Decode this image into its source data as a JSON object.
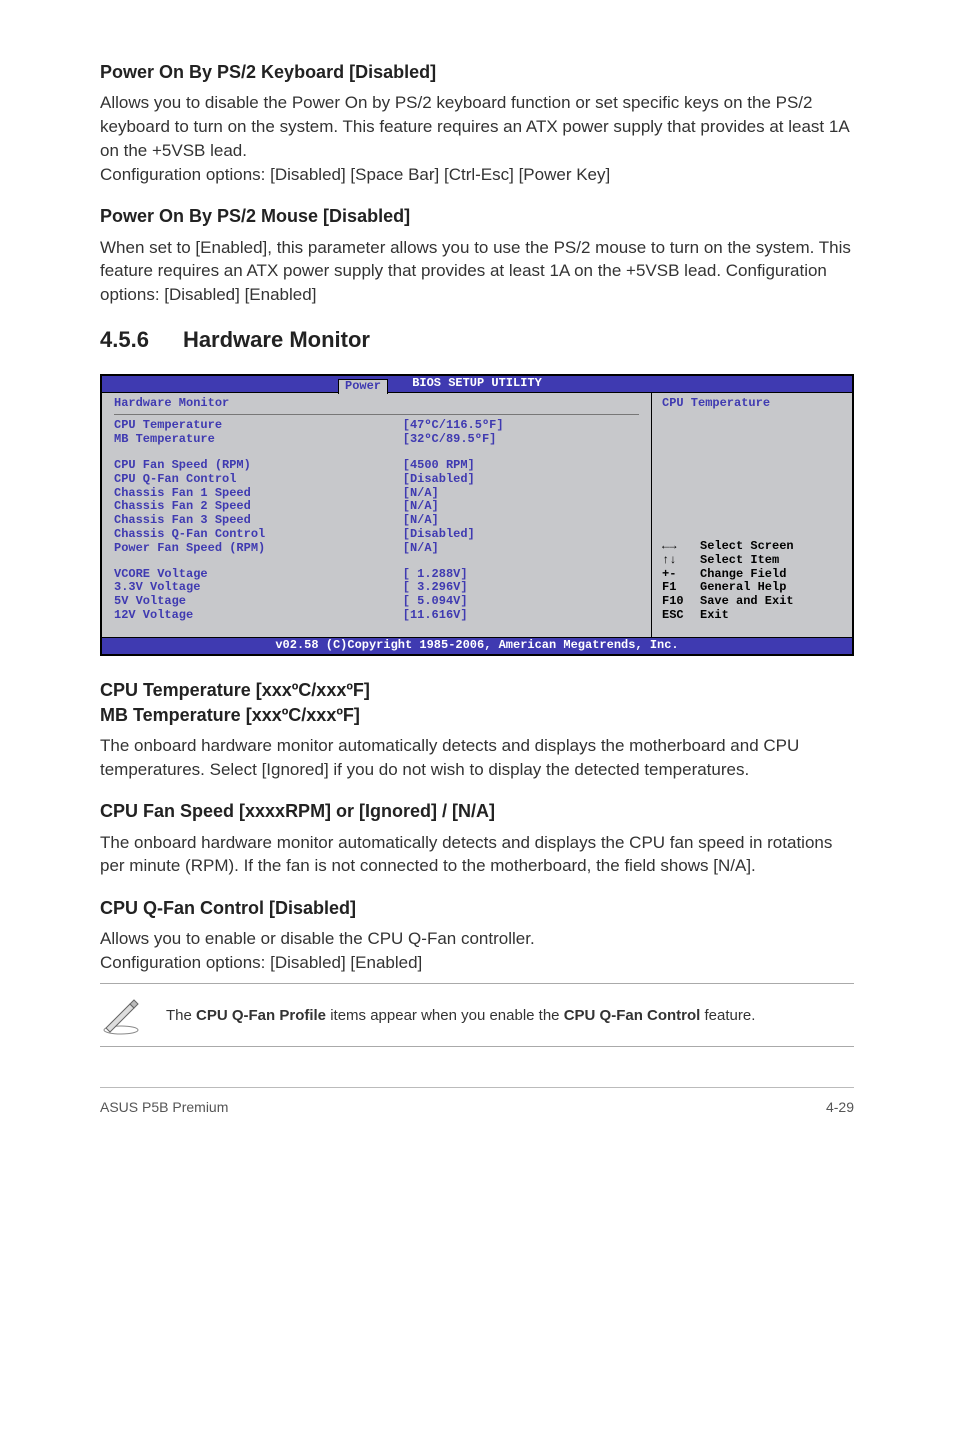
{
  "sections": {
    "block1": {
      "title": "Power On By PS/2 Keyboard [Disabled]",
      "body": "Allows you to disable the Power On by PS/2 keyboard function or set specific keys on the PS/2 keyboard to turn on the system. This feature requires an ATX power supply that provides at least 1A on the +5VSB lead.\nConfiguration options: [Disabled] [Space Bar] [Ctrl-Esc] [Power Key]"
    },
    "block2": {
      "title": "Power On By PS/2 Mouse [Disabled]",
      "body": "When set to [Enabled], this parameter allows you to use the PS/2 mouse to turn on the system. This feature requires an ATX power supply that provides at least 1A on the +5VSB lead. Configuration options: [Disabled] [Enabled]"
    },
    "section456": {
      "num": "4.5.6",
      "heading": "Hardware Monitor"
    },
    "temp": {
      "title_line1": "CPU Temperature [xxxºC/xxxºF]",
      "title_line2": "MB Temperature [xxxºC/xxxºF]",
      "body": "The onboard hardware monitor automatically detects and displays the motherboard and CPU temperatures. Select [Ignored] if you do not wish to display the detected temperatures."
    },
    "fanspeed": {
      "title": "CPU Fan Speed [xxxxRPM] or [Ignored] / [N/A]",
      "body": "The onboard hardware monitor automatically detects and displays the CPU fan speed in rotations per minute (RPM). If the fan is not connected to the motherboard, the field shows [N/A]."
    },
    "qfan": {
      "title": "CPU Q-Fan Control [Disabled]",
      "body": "Allows you to enable or disable the CPU Q-Fan controller.\nConfiguration options: [Disabled] [Enabled]"
    },
    "note": {
      "prefix": "The ",
      "bold1": "CPU Q-Fan Profile",
      "mid": " items appear when you enable the ",
      "bold2": "CPU Q-Fan Control",
      "suffix": " feature."
    }
  },
  "bios": {
    "header": "BIOS SETUP UTILITY",
    "tab": "Power",
    "panel_title": "Hardware Monitor",
    "rows_a": [
      {
        "label": "CPU Temperature",
        "val": "[47ºC/116.5ºF]"
      },
      {
        "label": "MB Temperature",
        "val": "[32ºC/89.5ºF]"
      }
    ],
    "rows_b": [
      {
        "label": "CPU Fan Speed (RPM)",
        "val": "[4500 RPM]"
      },
      {
        "label": "CPU Q-Fan Control",
        "val": "[Disabled]"
      },
      {
        "label": "Chassis Fan 1 Speed",
        "val": "[N/A]"
      },
      {
        "label": "Chassis Fan 2 Speed",
        "val": "[N/A]"
      },
      {
        "label": "Chassis Fan 3 Speed",
        "val": "[N/A]"
      },
      {
        "label": "Chassis Q-Fan Control",
        "val": "[Disabled]"
      },
      {
        "label": "Power Fan Speed (RPM)",
        "val": "[N/A]"
      }
    ],
    "rows_c": [
      {
        "label": "VCORE Voltage",
        "val": "[ 1.288V]"
      },
      {
        "label": "3.3V Voltage",
        "val": "[ 3.296V]"
      },
      {
        "label": "5V Voltage",
        "val": "[ 5.094V]"
      },
      {
        "label": "12V Voltage",
        "val": "[11.616V]"
      }
    ],
    "right_title": "CPU Temperature",
    "help": [
      {
        "k": "←→",
        "t": "Select Screen"
      },
      {
        "k": "↑↓",
        "t": "Select Item"
      },
      {
        "k": "+-",
        "t": "Change Field"
      },
      {
        "k": "F1",
        "t": "General Help"
      },
      {
        "k": "F10",
        "t": "Save and Exit"
      },
      {
        "k": "ESC",
        "t": "Exit"
      }
    ],
    "footer": "v02.58 (C)Copyright 1985-2006, American Megatrends, Inc."
  },
  "page_footer": {
    "left": "ASUS P5B Premium",
    "right": "4-29"
  }
}
